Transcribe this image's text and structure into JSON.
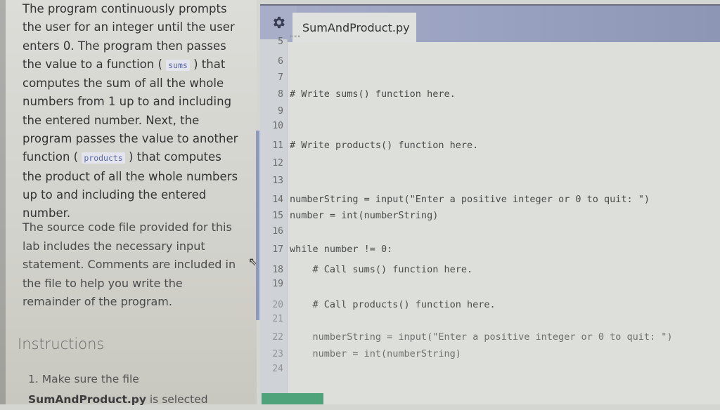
{
  "instructions_panel": {
    "para1_a": "The program continuously prompts the user for an integer until the user enters 0. The program then passes the value to a function (",
    "para1_code1": "sums",
    "para1_b": ") that computes the sum of all the whole numbers from 1 up to and including the entered number. Next, the program passes the value to another function (",
    "para1_code2": "products",
    "para1_c": ") that computes the product of all the whole numbers up to and including the entered number.",
    "para2": "The source code file provided for this lab includes the necessary input statement. Comments are included in the file to help you write the remainder of the program.",
    "heading": "Instructions",
    "step1_a": "1. Make sure the file ",
    "step1_file": "SumAndProduct.py",
    "step1_b": " is selected"
  },
  "editor": {
    "settings_icon": "gear-icon",
    "active_tab": "SumAndProduct.py",
    "lines": [
      {
        "n": "5",
        "text": "\"\"\""
      },
      {
        "n": "6",
        "text": ""
      },
      {
        "n": "7",
        "text": ""
      },
      {
        "n": "8",
        "text": "# Write sums() function here."
      },
      {
        "n": "9",
        "text": ""
      },
      {
        "n": "10",
        "text": ""
      },
      {
        "n": "11",
        "text": "# Write products() function here."
      },
      {
        "n": "12",
        "text": ""
      },
      {
        "n": "13",
        "text": ""
      },
      {
        "n": "14",
        "text": "numberString = input(\"Enter a positive integer or 0 to quit: \")"
      },
      {
        "n": "15",
        "text": "number = int(numberString)"
      },
      {
        "n": "16",
        "text": ""
      },
      {
        "n": "17",
        "text": "while number != 0:"
      },
      {
        "n": "18",
        "text": "    # Call sums() function here."
      },
      {
        "n": "19",
        "text": ""
      },
      {
        "n": "20",
        "text": "    # Call products() function here."
      },
      {
        "n": "21",
        "text": ""
      },
      {
        "n": "22",
        "text": "    numberString = input(\"Enter a positive integer or 0 to quit: \")"
      },
      {
        "n": "23",
        "text": "    number = int(numberString)"
      },
      {
        "n": "24",
        "text": ""
      }
    ]
  },
  "colors": {
    "tab_bar": "#9aa2c2",
    "run_button": "#4ea37a",
    "keyword": "#5a6a9a"
  }
}
